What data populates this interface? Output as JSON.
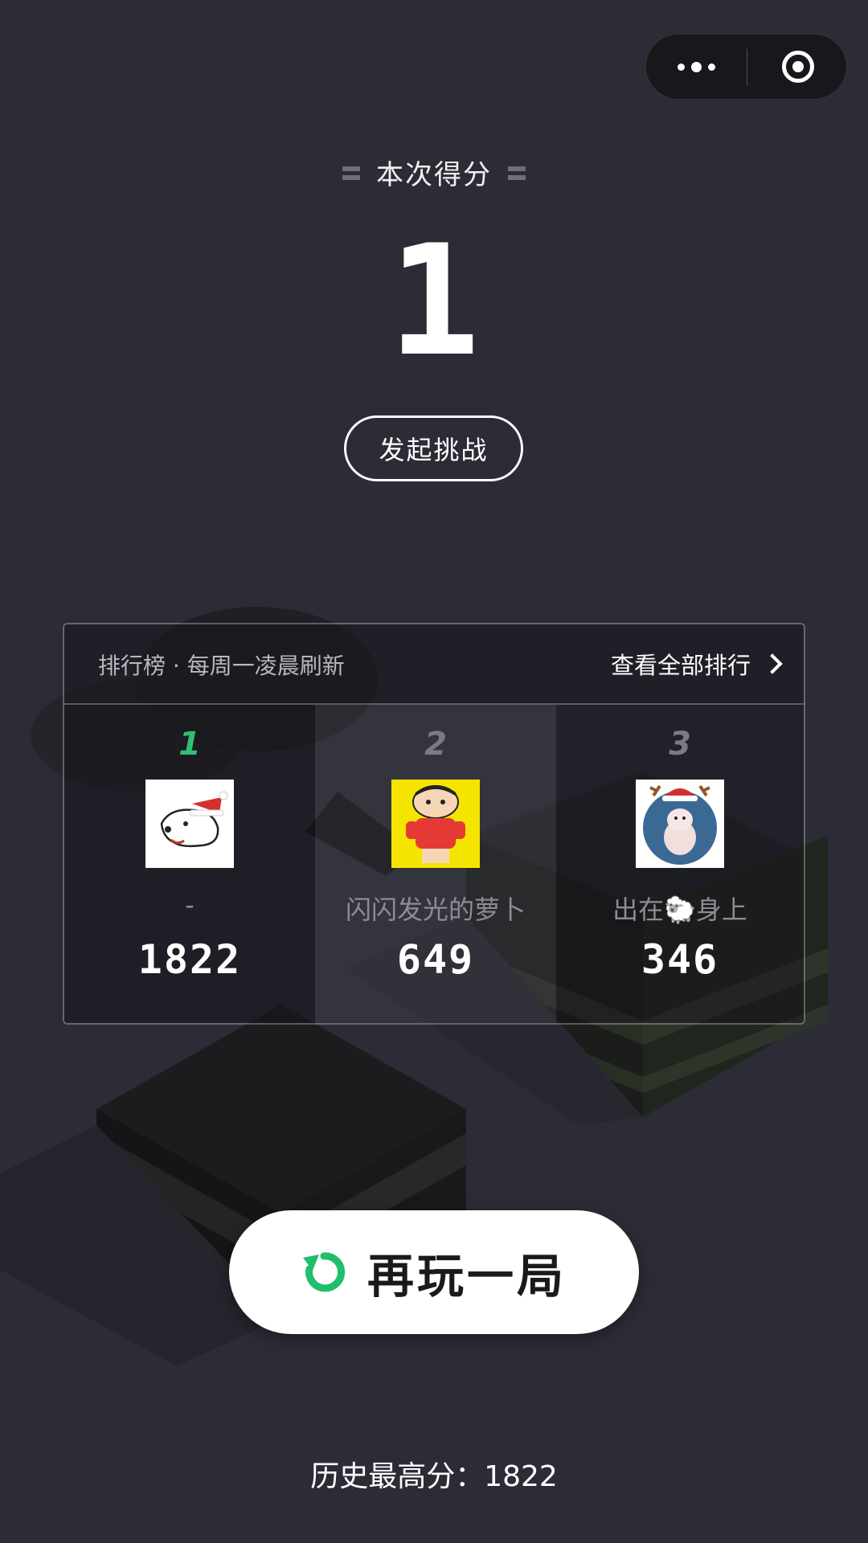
{
  "capsule": {
    "more_icon": "more-dots-icon",
    "close_icon": "target-circle-icon"
  },
  "score": {
    "label": "本次得分",
    "value": "1"
  },
  "challenge": {
    "label": "发起挑战"
  },
  "leaderboard": {
    "title": "排行榜 · 每周一凌晨刷新",
    "view_all": "查看全部排行",
    "entries": [
      {
        "rank": "1",
        "name": "-",
        "score": "1822",
        "avatar": "white-dog-santa-hat"
      },
      {
        "rank": "2",
        "name": "闪闪发光的萝卜",
        "score": "649",
        "avatar": "cartoon-boy-yellow"
      },
      {
        "rank": "3",
        "name": "出在🐑身上",
        "score": "346",
        "avatar": "pig-reindeer"
      }
    ]
  },
  "replay": {
    "label": "再玩一局",
    "icon": "refresh-icon"
  },
  "best": {
    "text": "历史最高分：1822"
  },
  "colors": {
    "background": "#2c2c36",
    "accent_green": "#2fbf71",
    "text_white": "#ffffff"
  }
}
